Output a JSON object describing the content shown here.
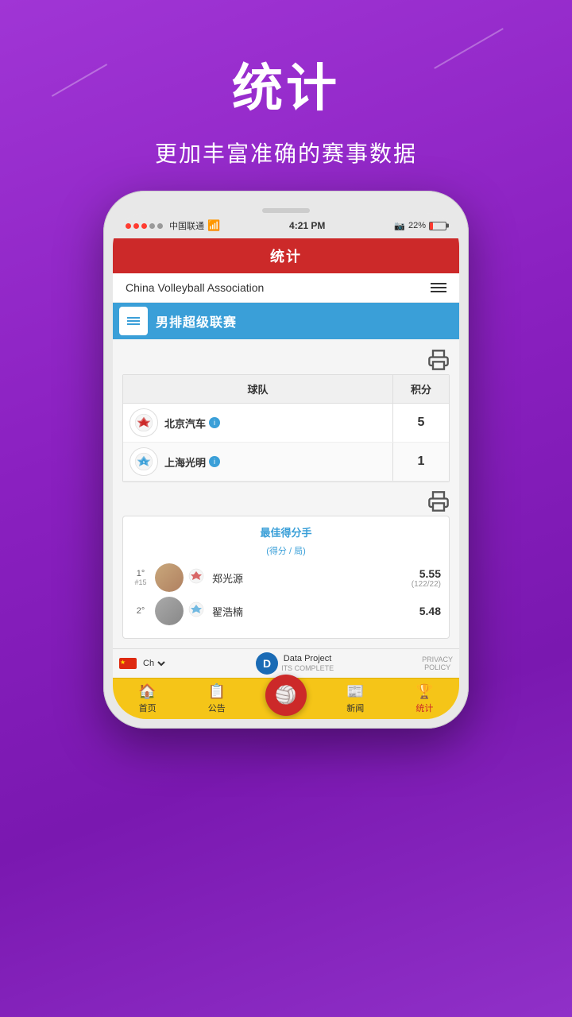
{
  "background": {
    "color": "#9b30d0"
  },
  "header": {
    "title": "统计",
    "subtitle": "更加丰富准确的赛事数据"
  },
  "status_bar": {
    "carrier": "中国联通",
    "time": "4:21 PM",
    "battery": "22%"
  },
  "app_nav": {
    "title": "统计"
  },
  "org_name": "China Volleyball Association",
  "league": {
    "name": "男排超级联赛"
  },
  "table": {
    "col_team": "球队",
    "col_pts": "积分",
    "rows": [
      {
        "name": "北京汽车",
        "pts": "5"
      },
      {
        "name": "上海光明",
        "pts": "1"
      }
    ]
  },
  "player_section": {
    "title": "最佳得分手",
    "subtitle": "(得分 / 局)",
    "players": [
      {
        "rank": "1°",
        "number": "#15",
        "name": "郑光源",
        "stat_main": "5.55",
        "stat_sub": "(122/22)"
      },
      {
        "rank": "2°",
        "number": "",
        "name": "翟浩楠",
        "stat_main": "5.48",
        "stat_sub": ""
      }
    ]
  },
  "bottom": {
    "lang": "Ch",
    "logo_name": "Data Project",
    "logo_tagline": "ITS COMPLETE",
    "privacy_label": "PRIVACY\nPOLICY"
  },
  "tabs": [
    {
      "label": "首页",
      "icon": "🏠",
      "active": false
    },
    {
      "label": "公告",
      "icon": "📋",
      "active": false
    },
    {
      "label": "",
      "icon": "",
      "active": false,
      "center": true
    },
    {
      "label": "新闻",
      "icon": "📰",
      "active": false
    },
    {
      "label": "统计",
      "icon": "🏆",
      "active": true
    }
  ]
}
